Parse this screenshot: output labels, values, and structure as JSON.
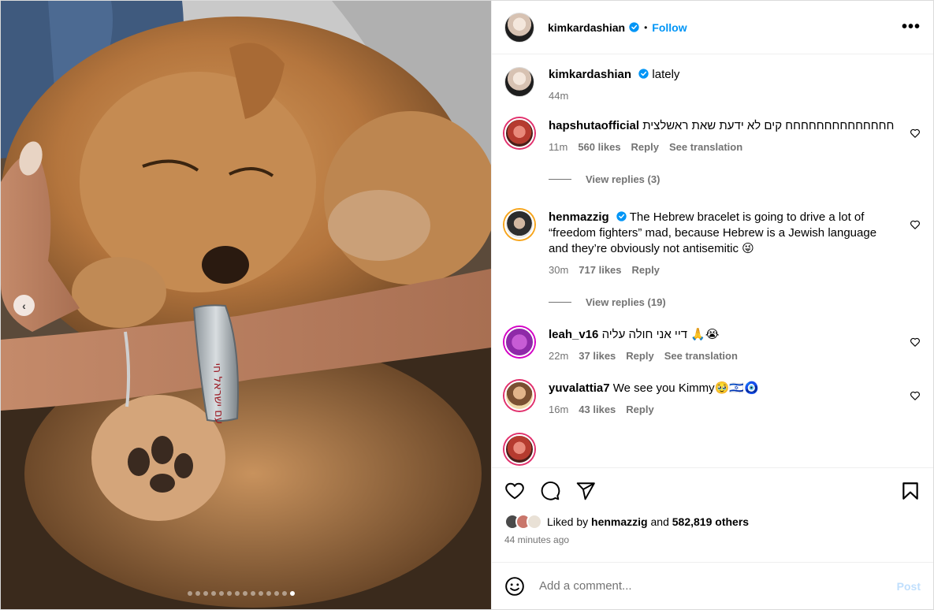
{
  "post": {
    "carousel_dots": 14,
    "active_dot": 13,
    "bracelet_text": "עם ישראל חי"
  },
  "header": {
    "username": "kimkardashian",
    "follow_label": "Follow",
    "more_label": "•••"
  },
  "caption": {
    "username": "kimkardashian",
    "text": "lately",
    "time": "44m"
  },
  "comments": [
    {
      "username": "hapshutaofficial",
      "text": "חחחחחחחחחחחחחח קים לא ידעת שאת ראשלצית",
      "time": "11m",
      "likes": "560 likes",
      "reply": "Reply",
      "translation": "See translation",
      "view_replies": "View replies (3)"
    },
    {
      "username": "henmazzig",
      "text": "The Hebrew bracelet is going to drive a lot of “freedom fighters” mad, because Hebrew is a Jewish language and they’re obviously not antisemitic 😜",
      "time": "30m",
      "likes": "717 likes",
      "reply": "Reply",
      "view_replies": "View replies (19)"
    },
    {
      "username": "leah_v16",
      "text": "דיי אני חולה עליה 🙏😭",
      "time": "22m",
      "likes": "37 likes",
      "reply": "Reply",
      "translation": "See translation"
    },
    {
      "username": "yuvalattia7",
      "text": "We see you Kimmy🥹🇮🇱🧿",
      "time": "16m",
      "likes": "43 likes",
      "reply": "Reply"
    }
  ],
  "likes": {
    "prefix": "Liked by",
    "user": "henmazzig",
    "and": "and",
    "others": "582,819 others",
    "ago": "44 minutes ago"
  },
  "add_comment": {
    "placeholder": "Add a comment...",
    "post_label": "Post"
  },
  "colors": {
    "link_blue": "#0095f6",
    "verified_blue": "#0095f6",
    "muted": "#737373",
    "post_disabled": "#c0dffd"
  }
}
